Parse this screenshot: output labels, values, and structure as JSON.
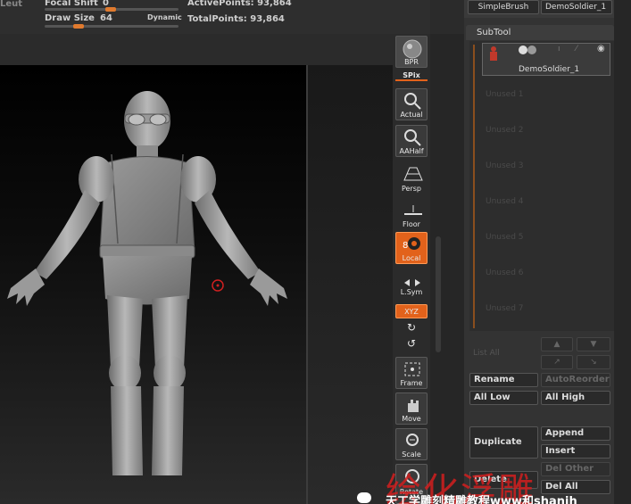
{
  "topbar": {
    "left_clip": "Leut",
    "focal_shift_label": "Focal Shift",
    "focal_shift_value": "0",
    "draw_size_label": "Draw Size",
    "draw_size_value": "64",
    "dynamic_label": "Dynamic",
    "active_points": "ActivePoints: 93,864",
    "total_points": "TotalPoints: 93,864",
    "accent": "#e2621b"
  },
  "tools": {
    "bpr": "BPR",
    "spix": "SPix",
    "actual": "Actual",
    "aahalf": "AAHalf",
    "persp": "Persp",
    "floor": "Floor",
    "local": "Local",
    "lsym": "L.Sym",
    "xyz": "XYZ",
    "frame": "Frame",
    "move": "Move",
    "scale": "Scale",
    "rotate": "Rotate"
  },
  "panel": {
    "brush_name": "SimpleBrush",
    "tool_name": "DemoSoldier_1",
    "subtool_title": "SubTool",
    "subtool_item": "DemoSoldier_1",
    "unused": [
      "Unused 1",
      "Unused 2",
      "Unused 3",
      "Unused 4",
      "Unused 5",
      "Unused 6",
      "Unused 7"
    ],
    "list_all": "List All",
    "rename": "Rename",
    "auto_reorder": "AutoReorder",
    "all_low": "All Low",
    "all_high": "All High",
    "duplicate": "Duplicate",
    "append": "Append",
    "insert": "Insert",
    "delete": "Delete",
    "del_other": "Del Other",
    "del_all": "Del All"
  },
  "watermark": {
    "main": "绘化浮雕",
    "sub": "天工学雕刻精雕教程www和shanjh"
  }
}
